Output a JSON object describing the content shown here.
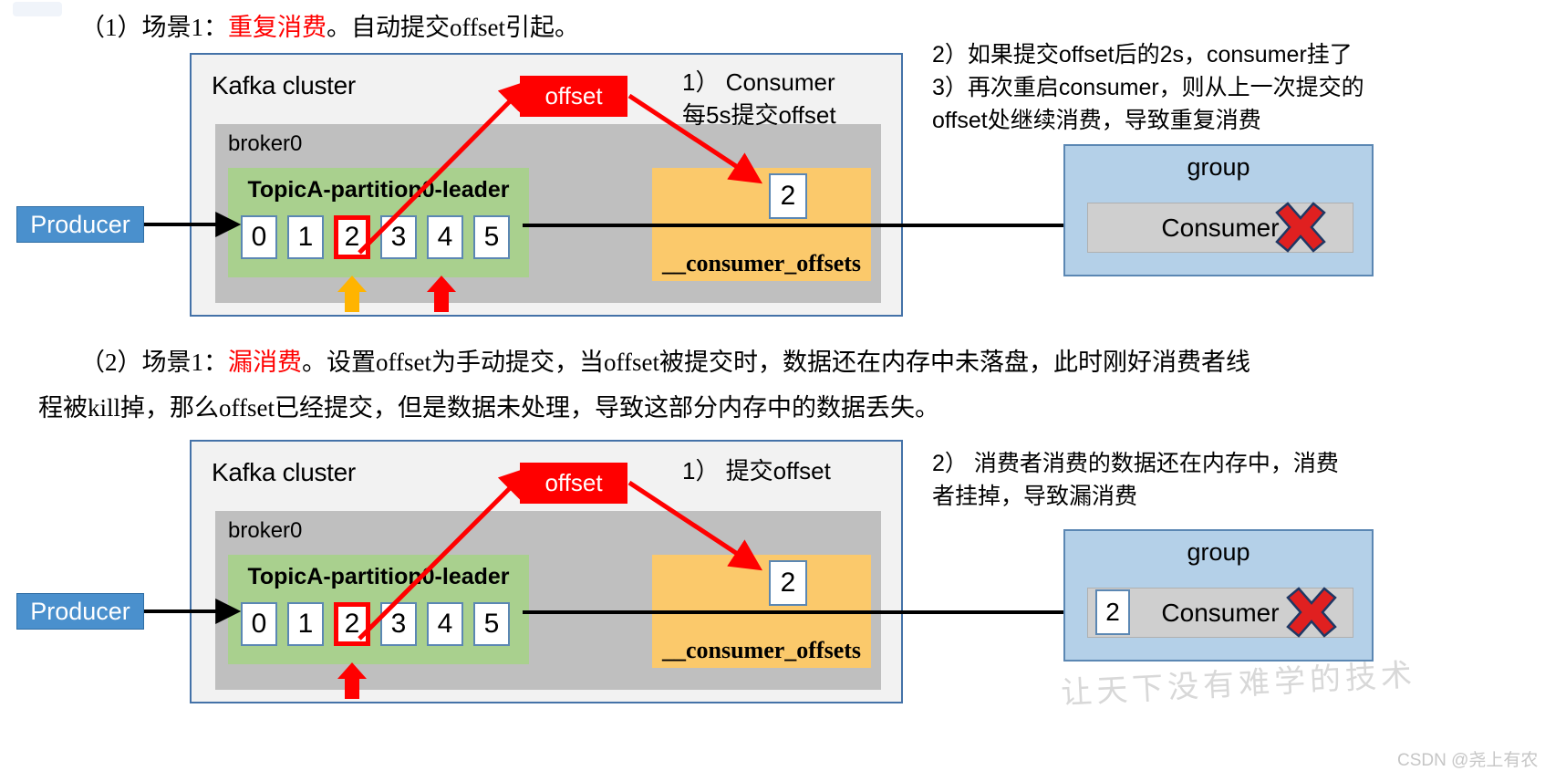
{
  "page": {
    "watermark": "让天下没有难学的技术",
    "credit": "CSDN @尧上有农"
  },
  "section1": {
    "heading_prefix": "（1）场景1：",
    "heading_red": "重复消费",
    "heading_suffix": "。自动提交offset引起。",
    "diagram": {
      "cluster_title": "Kafka cluster",
      "broker_title": "broker0",
      "partition_title": "TopicA-partition0-leader",
      "cells": [
        "0",
        "1",
        "2",
        "3",
        "4",
        "5"
      ],
      "highlight_cell": "2",
      "offset_chip": "offset",
      "offsets_topic_label": "__consumer_offsets",
      "offsets_topic_cell": "2",
      "producer": "Producer",
      "group_title": "group",
      "consumer_label": "Consumer",
      "inner_note": "1）  Consumer\n每5s提交offset",
      "arrow_up_orange": "committed-offset-marker",
      "arrow_up_red": "current-read-marker"
    },
    "side_notes": "2）如果提交offset后的2s，consumer挂了\n3）再次重启consumer，则从上一次提交的\noffset处继续消费，导致重复消费"
  },
  "section2": {
    "heading_prefix": "（2）场景1：",
    "heading_red": "漏消费",
    "heading_suffix": "。设置offset为手动提交，当offset被提交时，数据还在内存中未落盘，此时刚好消费者线",
    "heading_line2": "程被kill掉，那么offset已经提交，但是数据未处理，导致这部分内存中的数据丢失。",
    "diagram": {
      "cluster_title": "Kafka cluster",
      "broker_title": "broker0",
      "partition_title": "TopicA-partition0-leader",
      "cells": [
        "0",
        "1",
        "2",
        "3",
        "4",
        "5"
      ],
      "highlight_cell": "2",
      "offset_chip": "offset",
      "offsets_topic_label": "__consumer_offsets",
      "offsets_topic_cell": "2",
      "producer": "Producer",
      "group_title": "group",
      "consumer_label": "Consumer",
      "consumer_cell": "2",
      "inner_note": "1）  提交offset",
      "arrow_up_red": "current-read-marker"
    },
    "side_notes": "2）  消费者消费的数据还在内存中，消费\n者挂掉，导致漏消费"
  },
  "colors": {
    "red": "#ff0000",
    "orange_arrow": "#ffb400",
    "producer_blue": "#4a90cd",
    "group_blue": "#b4d0e8",
    "partition_green": "#a9d08e",
    "broker_gray": "#bfbfbf",
    "offsets_orange": "#fbc96b"
  }
}
